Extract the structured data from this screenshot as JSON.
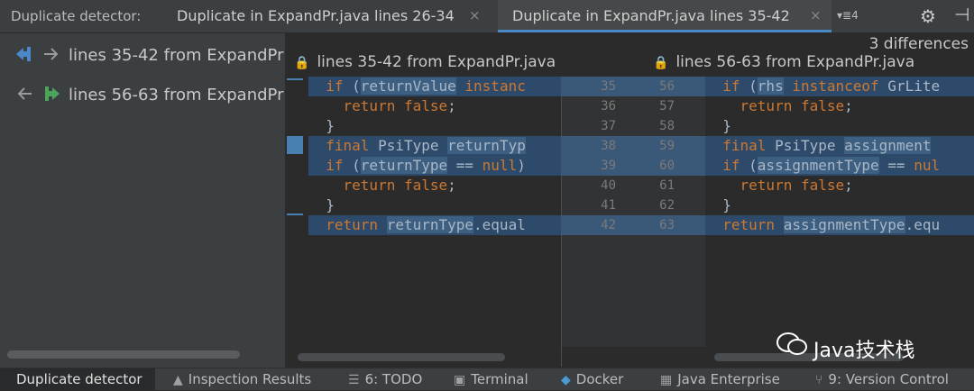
{
  "header": {
    "title": "Duplicate detector:",
    "tabs": [
      {
        "label": "Duplicate in ExpandPr.java lines 26-34",
        "close": "×"
      },
      {
        "label": "Duplicate in ExpandPr.java lines 35-42",
        "close": "×"
      }
    ],
    "overflow_label": "▾≣4"
  },
  "navigator": {
    "items": [
      {
        "label": "lines 35-42 from ExpandPr",
        "icon1": "jump-left-icon",
        "icon2": "arrow-right-icon"
      },
      {
        "label": "lines 56-63 from ExpandPr",
        "icon1": "arrow-left-icon",
        "icon2": "jump-right-icon"
      }
    ]
  },
  "diff": {
    "differences": "3 differences",
    "left_header": "lines 35-42 from ExpandPr.java",
    "right_header": "lines 56-63 from ExpandPr.java",
    "left_numbers": [
      "35",
      "36",
      "37",
      "38",
      "39",
      "40",
      "41",
      "42"
    ],
    "right_numbers": [
      "56",
      "57",
      "58",
      "59",
      "60",
      "61",
      "62",
      "63"
    ]
  },
  "watermark": "Java技术栈",
  "bottom_tabs": [
    {
      "label": "Duplicate detector",
      "icon": ""
    },
    {
      "label": "Inspection Results",
      "icon": "inspection-icon"
    },
    {
      "label": "6: TODO",
      "icon": "todo-icon"
    },
    {
      "label": "Terminal",
      "icon": "terminal-icon"
    },
    {
      "label": "Docker",
      "icon": "docker-icon"
    },
    {
      "label": "Java Enterprise",
      "icon": "java-enterprise-icon"
    },
    {
      "label": "9: Version Control",
      "icon": "version-control-icon"
    }
  ],
  "colors": {
    "highlight": "#3d5f82",
    "keyword": "#cc7832",
    "accent": "#4a88c7"
  }
}
